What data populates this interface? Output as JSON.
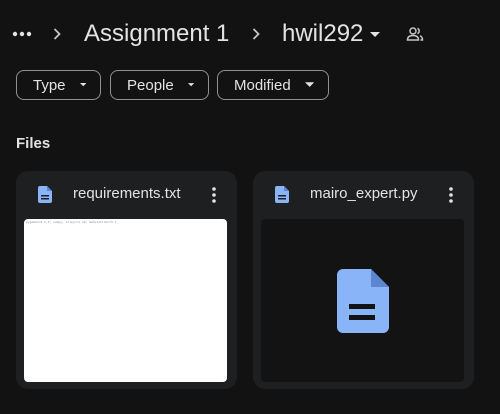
{
  "breadcrumb": {
    "parent": "Assignment 1",
    "current": "hwil292"
  },
  "filters": [
    {
      "label": "Type"
    },
    {
      "label": "People"
    },
    {
      "label": "Modified"
    }
  ],
  "section_title": "Files",
  "files": [
    {
      "name": "requirements.txt",
      "preview_text": "pygame==2.1.3; numpy; scipy==1.10; matplotlib==3.7"
    },
    {
      "name": "mairo_expert.py"
    }
  ],
  "colors": {
    "background": "#121212",
    "card": "#1e1f20",
    "file_icon": "#8ab4f8",
    "chip_border": "#8e918f",
    "text": "#e3e3e3"
  }
}
